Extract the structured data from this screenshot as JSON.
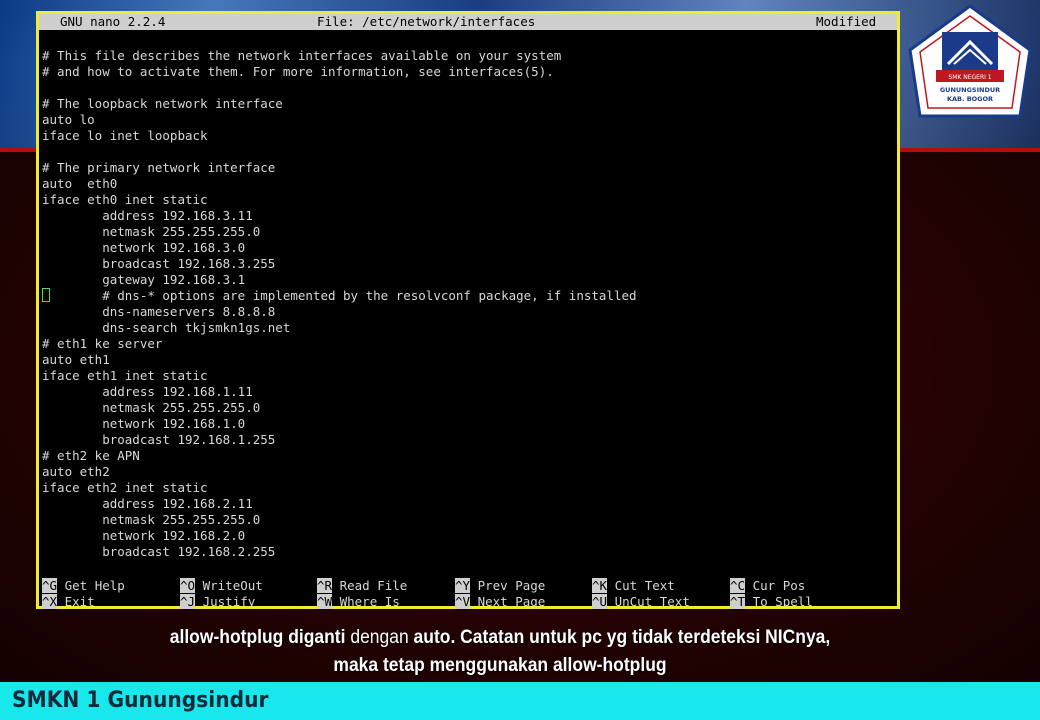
{
  "colors": {
    "terminal_border": "#f2ea2c",
    "terminal_bg": "#000000",
    "terminal_text": "#d8d8d8",
    "titlebar_bg": "#cfcfcf",
    "footer_bg": "#18e7ec",
    "cursor": "#3fe05a"
  },
  "titlebar": {
    "app": "GNU nano 2.2.4",
    "file": "File: /etc/network/interfaces",
    "status": "Modified"
  },
  "file_lines": [
    "# This file describes the network interfaces available on your system",
    "# and how to activate them. For more information, see interfaces(5).",
    "",
    "# The loopback network interface",
    "auto lo",
    "iface lo inet loopback",
    "",
    "# The primary network interface",
    "auto  eth0",
    "iface eth0 inet static",
    "        address 192.168.3.11",
    "        netmask 255.255.255.0",
    "        network 192.168.3.0",
    "        broadcast 192.168.3.255",
    "        gateway 192.168.3.1",
    "        # dns-* options are implemented by the resolvconf package, if installed",
    "        dns-nameservers 8.8.8.8",
    "        dns-search tkjsmkn1gs.net",
    "# eth1 ke server",
    "auto eth1",
    "iface eth1 inet static",
    "        address 192.168.1.11",
    "        netmask 255.255.255.0",
    "        network 192.168.1.0",
    "        broadcast 192.168.1.255",
    "# eth2 ke APN",
    "auto eth2",
    "iface eth2 inet static",
    "        address 192.168.2.11",
    "        netmask 255.255.255.0",
    "        network 192.168.2.0",
    "        broadcast 192.168.2.255"
  ],
  "shortcuts": {
    "row1": [
      {
        "key": "^G",
        "label": " Get Help"
      },
      {
        "key": "^O",
        "label": " WriteOut"
      },
      {
        "key": "^R",
        "label": " Read File"
      },
      {
        "key": "^Y",
        "label": " Prev Page"
      },
      {
        "key": "^K",
        "label": " Cut Text"
      },
      {
        "key": "^C",
        "label": " Cur Pos"
      }
    ],
    "row2": [
      {
        "key": "^X",
        "label": " Exit"
      },
      {
        "key": "^J",
        "label": " Justify"
      },
      {
        "key": "^W",
        "label": " Where Is"
      },
      {
        "key": "^V",
        "label": " Next Page"
      },
      {
        "key": "^U",
        "label": " UnCut Text"
      },
      {
        "key": "^T",
        "label": " To Spell"
      }
    ]
  },
  "caption": {
    "part1": "allow-hotplug diganti",
    "part2": " dengan ",
    "part3": "auto. Catatan untuk pc yg tidak terdeteksi NICnya,",
    "line2": "maka tetap menggunakan allow-hotplug"
  },
  "logo": {
    "top_text": "SMK NEGERI 1",
    "mid_text": "GUNUNGSINDUR",
    "bottom_text": "KAB. BOGOR"
  },
  "footer": {
    "title": "SMKN 1 Gunungsindur"
  }
}
